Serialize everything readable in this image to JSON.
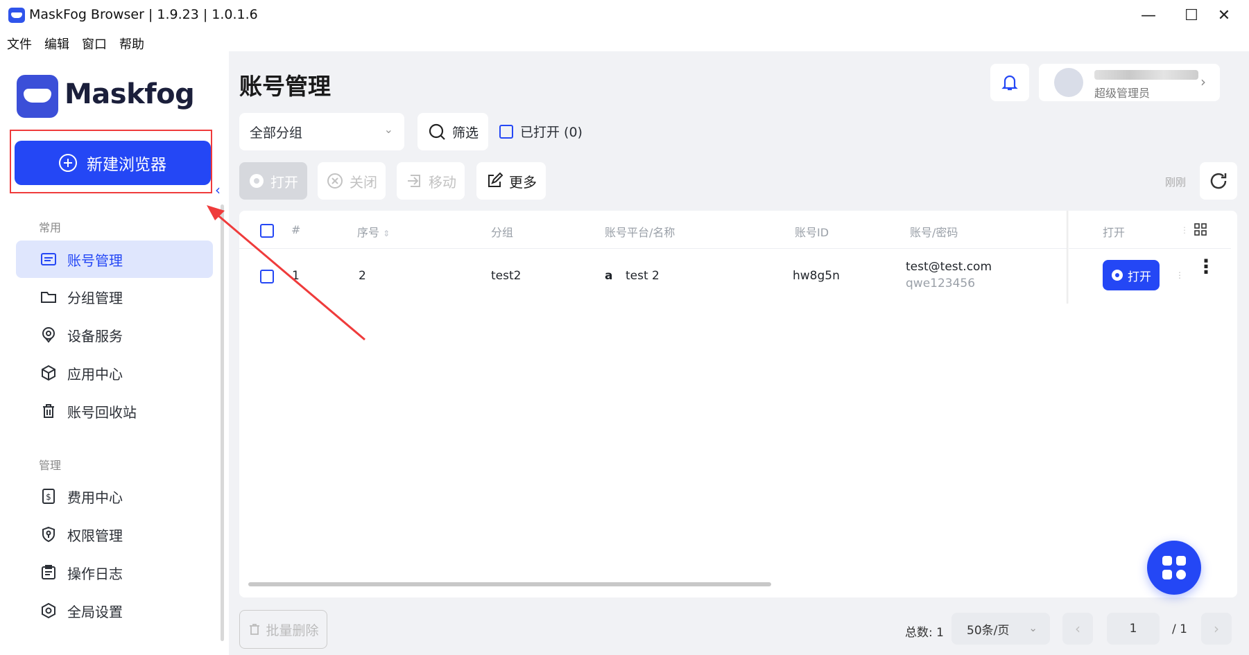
{
  "window": {
    "title": "MaskFog Browser | 1.9.23 | 1.0.1.6",
    "minimize": "—",
    "maximize": "☐",
    "close": "✕"
  },
  "menu": [
    "文件",
    "编辑",
    "窗口",
    "帮助"
  ],
  "sidebar": {
    "logo_text": "Maskfog",
    "new_browser_label": "新建浏览器",
    "section_common": "常用",
    "section_manage": "管理",
    "common_items": [
      {
        "label": "账号管理",
        "icon": "account-list-icon",
        "active": true
      },
      {
        "label": "分组管理",
        "icon": "folder-icon"
      },
      {
        "label": "设备服务",
        "icon": "location-pin-icon"
      },
      {
        "label": "应用中心",
        "icon": "cube-icon"
      },
      {
        "label": "账号回收站",
        "icon": "trash-icon"
      }
    ],
    "manage_items": [
      {
        "label": "费用中心",
        "icon": "billing-icon"
      },
      {
        "label": "权限管理",
        "icon": "shield-key-icon"
      },
      {
        "label": "操作日志",
        "icon": "log-icon"
      },
      {
        "label": "全局设置",
        "icon": "settings-hex-icon"
      }
    ]
  },
  "main": {
    "page_title": "账号管理",
    "user_role": "超级管理员",
    "group_select_value": "全部分组",
    "filter_label": "筛选",
    "opened_filter_label": "已打开 (0)",
    "toolbar": {
      "open": "打开",
      "close": "关闭",
      "move": "移动",
      "more": "更多"
    },
    "refresh_time": "刚刚"
  },
  "table": {
    "headers": {
      "index": "#",
      "serial": "序号",
      "group": "分组",
      "platform_name": "账号平台/名称",
      "account_id": "账号ID",
      "account_password": "账号/密码",
      "open": "打开"
    },
    "rows": [
      {
        "index": "1",
        "serial": "2",
        "group": "test2",
        "platform_icon": "amazon-icon",
        "platform_glyph": "a",
        "name": "test 2",
        "account_id": "hw8g5n",
        "account": "test@test.com",
        "password": "qwe123456",
        "open_label": "打开"
      }
    ]
  },
  "footer": {
    "batch_delete": "批量删除",
    "total": "总数: 1",
    "page_size": "50条/页",
    "current_page": "1",
    "total_pages": "/ 1",
    "prev": "‹",
    "next": "›"
  },
  "colors": {
    "primary": "#2447f5",
    "annotation_red": "#ef3b3b",
    "background": "#f1f2f5"
  }
}
